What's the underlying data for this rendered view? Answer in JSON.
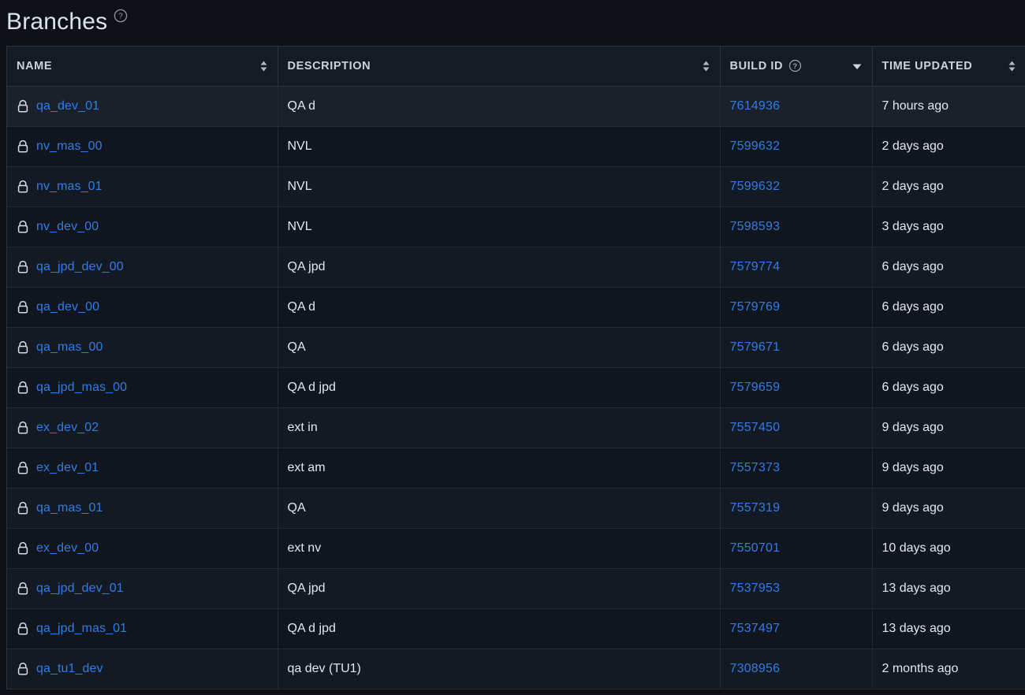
{
  "header": {
    "title": "Branches",
    "help_icon": "question-circle-icon"
  },
  "table": {
    "columns": [
      {
        "key": "name",
        "label": "NAME",
        "sort": "both",
        "help": false
      },
      {
        "key": "desc",
        "label": "DESCRIPTION",
        "sort": "both",
        "help": false
      },
      {
        "key": "build",
        "label": "BUILD ID",
        "sort": "desc",
        "help": true
      },
      {
        "key": "time",
        "label": "TIME UPDATED",
        "sort": "both",
        "help": false
      }
    ],
    "rows": [
      {
        "lock": "lock-icon",
        "name": "qa_dev_01",
        "desc": "QA d",
        "build": "7614936",
        "time": "7 hours ago",
        "hovered": true
      },
      {
        "lock": "lock-icon",
        "name": "nv_mas_00",
        "desc": "NVL",
        "build": "7599632",
        "time": "2 days ago",
        "hovered": false
      },
      {
        "lock": "lock-icon",
        "name": "nv_mas_01",
        "desc": "NVL",
        "build": "7599632",
        "time": "2 days ago",
        "hovered": false
      },
      {
        "lock": "lock-icon",
        "name": "nv_dev_00",
        "desc": "NVL",
        "build": "7598593",
        "time": "3 days ago",
        "hovered": false
      },
      {
        "lock": "lock-icon",
        "name": "qa_jpd_dev_00",
        "desc": "QA jpd",
        "build": "7579774",
        "time": "6 days ago",
        "hovered": false
      },
      {
        "lock": "lock-icon",
        "name": "qa_dev_00",
        "desc": "QA d",
        "build": "7579769",
        "time": "6 days ago",
        "hovered": false
      },
      {
        "lock": "lock-icon",
        "name": "qa_mas_00",
        "desc": "QA",
        "build": "7579671",
        "time": "6 days ago",
        "hovered": false
      },
      {
        "lock": "lock-icon",
        "name": "qa_jpd_mas_00",
        "desc": "QA d jpd",
        "build": "7579659",
        "time": "6 days ago",
        "hovered": false
      },
      {
        "lock": "lock-icon",
        "name": "ex_dev_02",
        "desc": "ext in",
        "build": "7557450",
        "time": "9 days ago",
        "hovered": false
      },
      {
        "lock": "lock-icon",
        "name": "ex_dev_01",
        "desc": "ext am",
        "build": "7557373",
        "time": "9 days ago",
        "hovered": false
      },
      {
        "lock": "lock-icon",
        "name": "qa_mas_01",
        "desc": "QA",
        "build": "7557319",
        "time": "9 days ago",
        "hovered": false
      },
      {
        "lock": "lock-icon",
        "name": "ex_dev_00",
        "desc": "ext nv",
        "build": "7550701",
        "time": "10 days ago",
        "hovered": false
      },
      {
        "lock": "lock-icon",
        "name": "qa_jpd_dev_01",
        "desc": "QA jpd",
        "build": "7537953",
        "time": "13 days ago",
        "hovered": false
      },
      {
        "lock": "lock-icon",
        "name": "qa_jpd_mas_01",
        "desc": "QA d jpd",
        "build": "7537497",
        "time": "13 days ago",
        "hovered": false
      },
      {
        "lock": "lock-icon",
        "name": "qa_tu1_dev",
        "desc": "qa dev (TU1)",
        "build": "7308956",
        "time": "2 months ago",
        "hovered": false
      }
    ]
  },
  "colors": {
    "page_background": "#0d1117",
    "link": "#2f7ce6",
    "row_odd": "#141a23",
    "row_even": "#11161e",
    "border": "#222a35",
    "header_background": "#151b24"
  }
}
